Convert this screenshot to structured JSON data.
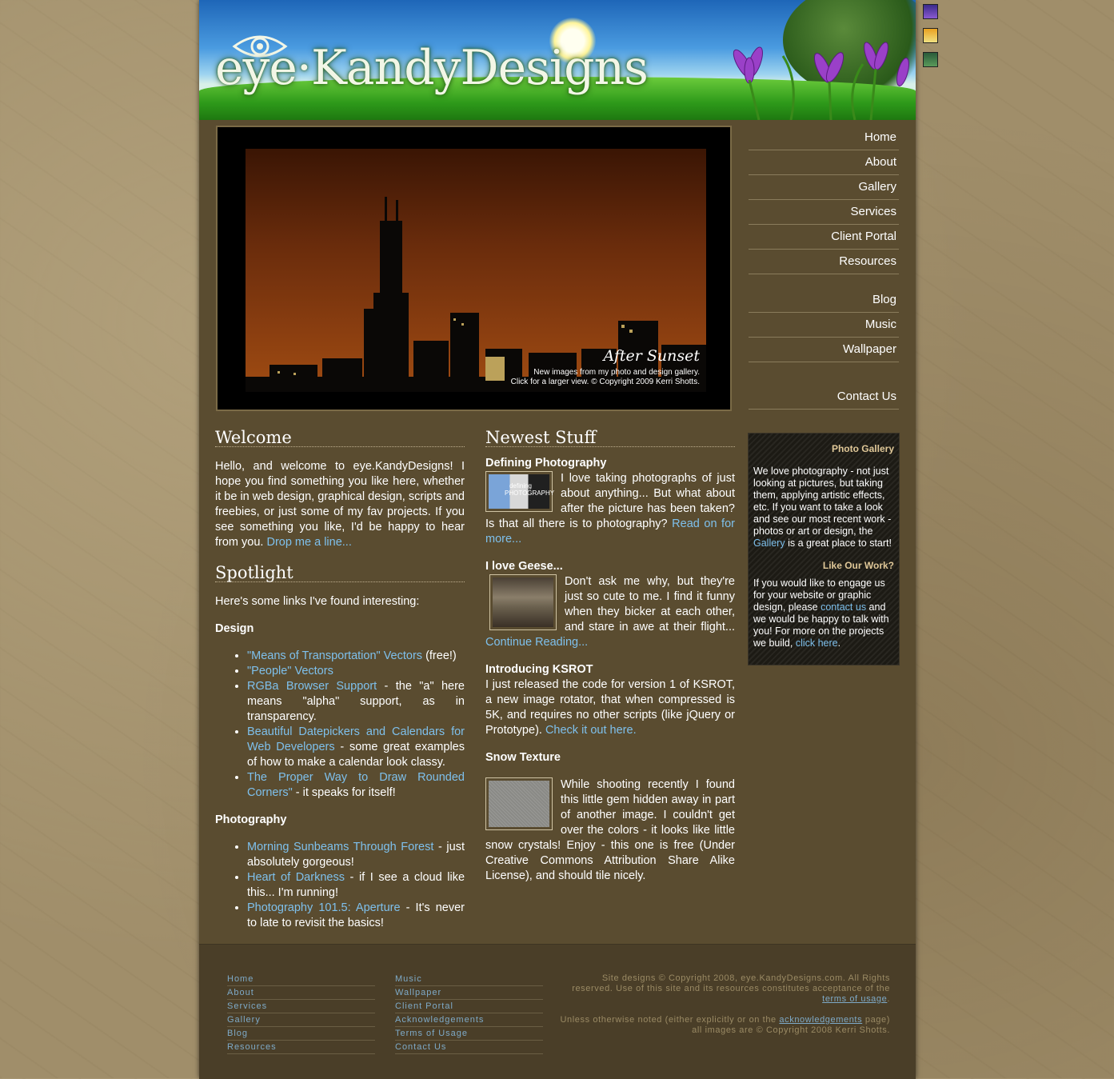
{
  "header": {
    "logo_text": "eye·KandyDesigns"
  },
  "banner": {
    "title": "After Sunset",
    "caption_line1": "New images from my photo and design gallery.",
    "caption_line2": "Click for a larger view. © Copyright 2009 Kerri Shotts."
  },
  "nav": {
    "home": "Home",
    "about": "About",
    "gallery": "Gallery",
    "services": "Services",
    "client_portal": "Client Portal",
    "resources": "Resources",
    "blog": "Blog",
    "music": "Music",
    "wallpaper": "Wallpaper",
    "contact": "Contact Us"
  },
  "welcome": {
    "heading": "Welcome",
    "text": "Hello, and welcome to eye.KandyDesigns! I hope you find something you like here, whether it be in web design, graphical design, scripts and freebies, or just some of my fav projects. If you see something you like, I'd be happy to hear from you. ",
    "link": "Drop me a line..."
  },
  "spotlight": {
    "heading": "Spotlight",
    "intro": "Here's some links I've found interesting:",
    "design_heading": "Design",
    "design": [
      {
        "link": "\"Means of Transportation\" Vectors",
        "text": " (free!)"
      },
      {
        "link": "\"People\" Vectors",
        "text": ""
      },
      {
        "link": "RGBa Browser Support",
        "text": " - the \"a\" here means \"alpha\" support, as in transparency."
      },
      {
        "link": "Beautiful Datepickers and Calendars for Web Developers",
        "text": " - some great examples of how to make a calendar look classy."
      },
      {
        "link": "The Proper Way to Draw Rounded Corners\"",
        "text": " - it speaks for itself!"
      }
    ],
    "photo_heading": "Photography",
    "photography": [
      {
        "link": "Morning Sunbeams Through Forest",
        "text": " - just absolutely gorgeous!"
      },
      {
        "link": "Heart of Darkness",
        "text": " - if I see a cloud like this... I'm running!"
      },
      {
        "link": "Photography 101.5: Aperture",
        "text": " - It's never to late to revisit the basics!"
      }
    ]
  },
  "newest": {
    "heading": "Newest Stuff",
    "items": [
      {
        "title": "Defining Photography",
        "text": "I love taking photographs of just about anything... But what about after the picture has been taken? Is that all there is to photography? ",
        "link": "Read on for more..."
      },
      {
        "title": "I love Geese...",
        "text": "Don't ask me why, but they're just so cute to me. I find it funny when they bicker at each other, and stare in awe at their flight... ",
        "link": "Continue Reading..."
      },
      {
        "title": "Introducing KSROT",
        "text": "I just released the code for version 1 of KSROT, a new image rotator, that when compressed is 5K, and requires no other scripts (like jQuery or Prototype). ",
        "link": "Check it out here."
      },
      {
        "title": "Snow Texture",
        "text": "While shooting recently I found this little gem hidden away in part of another image. I couldn't get over the colors - it looks like little snow crystals! Enjoy - this one is free (Under Creative Commons Attribution Share Alike License), and should tile nicely.",
        "link": ""
      }
    ],
    "thumb1_text": "defining PHOTOGRAPHY"
  },
  "sidebar": {
    "gallery_heading": "Photo Gallery",
    "gallery_text_1": "We love photography - not just looking at pictures, but taking them, applying artistic effects, etc. If you want to take a look and see our most recent work - photos or art or design, the ",
    "gallery_link": "Gallery",
    "gallery_text_2": " is a great place to start!",
    "work_heading": "Like Our Work?",
    "work_text_1": "If you would like to engage us for your website or graphic design, please ",
    "work_link_1": "contact us",
    "work_text_2": " and we would be happy to talk with you! For more on the projects we build, ",
    "work_link_2": "click here",
    "work_text_3": "."
  },
  "footer": {
    "col1": [
      "Home",
      "About",
      "Services",
      "Gallery",
      "Blog",
      "Resources"
    ],
    "col2": [
      "Music",
      "Wallpaper",
      "Client Portal",
      "Acknowledgements",
      "Terms of Usage",
      "Contact Us"
    ],
    "note1_a": "Site designs © Copyright 2008, eye.KandyDesigns.com. All Rights reserved. Use of this site and its resources constitutes acceptance of the ",
    "note1_link": "terms of usage",
    "note1_b": ".",
    "note2_a": "Unless otherwise noted (either explicitly or on the ",
    "note2_link": "acknowledgements",
    "note2_b": " page) all images are © Copyright 2008 Kerri Shotts."
  },
  "colors": {
    "page_bg": "#5a4c30",
    "link": "#7ec0ec",
    "footer_link": "#7eaac8",
    "nav_text": "#ffffff"
  }
}
